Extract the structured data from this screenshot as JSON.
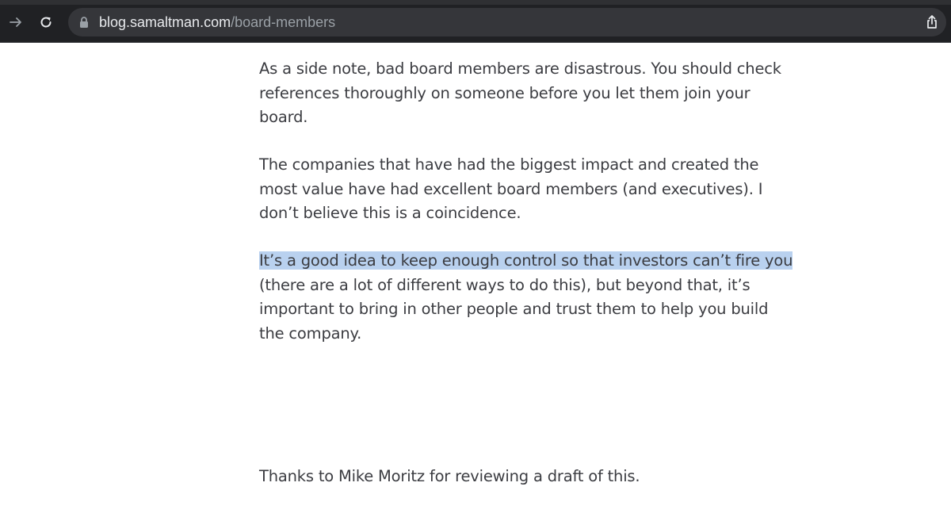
{
  "browser": {
    "url_domain": "blog.samaltman.com",
    "url_path": "/board-members",
    "icons": {
      "forward": "arrow-right-icon",
      "reload": "reload-icon",
      "lock": "lock-icon",
      "share": "share-icon"
    },
    "colors": {
      "toolbar_bg": "#202124",
      "omnibox_bg": "#35363a",
      "domain_text": "#e8eaed",
      "path_text": "#9aa0a6"
    }
  },
  "article": {
    "paragraphs": [
      {
        "lines": [
          "As a side note, bad board members are disastrous.  You should check",
          "references thoroughly on someone before you let them join your",
          "board."
        ]
      },
      {
        "lines": [
          "The companies that have had the biggest impact and created the",
          "most value have had excellent board members (and executives).  I",
          "don’t believe this is a coincidence."
        ]
      },
      {
        "highlighted_line": "It’s a good idea to keep enough control so that investors can’t fire you",
        "lines": [
          "(there are a lot of different ways to do this), but beyond that, it’s",
          "important to bring in other people and trust them to help you build",
          "the company."
        ]
      }
    ],
    "thanks": "Thanks to Mike Moritz for reviewing a draft of this.",
    "colors": {
      "text": "#3b3c41",
      "selection_highlight": "#b9d1ef"
    }
  }
}
